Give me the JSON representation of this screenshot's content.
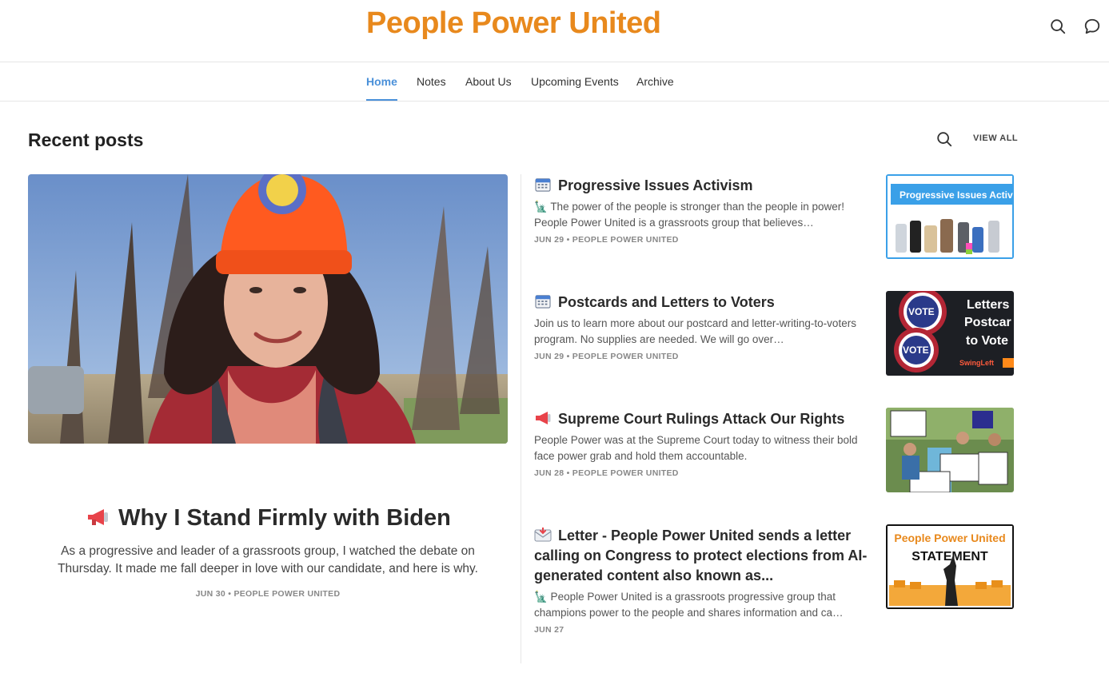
{
  "header": {
    "site_title": "People Power United"
  },
  "nav": {
    "items": [
      {
        "label": "Home",
        "active": true
      },
      {
        "label": "Notes",
        "active": false
      },
      {
        "label": "About Us",
        "active": false
      },
      {
        "label": "Upcoming Events",
        "active": false
      },
      {
        "label": "Archive",
        "active": false
      }
    ]
  },
  "section": {
    "title": "Recent posts",
    "view_all": "VIEW ALL"
  },
  "featured": {
    "emoji": "megaphone-icon",
    "title": "Why I Stand Firmly with Biden",
    "subtitle": "As a progressive and leader of a grassroots group, I watched the debate on Thursday. It made me fall deeper in love with our candidate, and here is why.",
    "meta": "JUN 30 • PEOPLE POWER UNITED"
  },
  "posts": [
    {
      "emoji": "calendar-icon",
      "title": "Progressive Issues Activism",
      "excerpt": "🗽 The power of the people is stronger than the people in power! People Power United is a grassroots group that believes…",
      "meta": "JUN 29 • PEOPLE POWER UNITED",
      "thumb_text": "Progressive Issues Activ"
    },
    {
      "emoji": "calendar-icon",
      "title": "Postcards and Letters to Voters",
      "excerpt": "Join us to learn more about our postcard and letter-writing-to-voters program. No supplies are needed. We will go over…",
      "meta": "JUN 29 • PEOPLE POWER UNITED",
      "thumb_text_1": "Letters",
      "thumb_text_2": "Postcar",
      "thumb_text_3": "to Vote",
      "thumb_badge_1": "VOTE",
      "thumb_badge_2": "VOTE",
      "thumb_brand": "SwingLeft"
    },
    {
      "emoji": "megaphone-icon",
      "title": "Supreme Court Rulings Attack Our Rights",
      "excerpt": "People Power was at the Supreme Court today to witness their bold face power grab and hold them accountable.",
      "meta": "JUN 28 • PEOPLE POWER UNITED"
    },
    {
      "emoji": "envelope-icon",
      "title": "Letter - People Power United sends a letter calling on Congress to protect elections from AI-generated content also known as...",
      "excerpt": "🗽  People Power United is a grassroots progressive group that champions power to the people and shares information and ca…",
      "meta": "JUN 27",
      "thumb_text_1": "People Power United",
      "thumb_text_2": "STATEMENT"
    }
  ],
  "colors": {
    "brand": "#e8891d",
    "nav_active": "#4a90d9",
    "thumb_blue": "#3aa0e8"
  }
}
